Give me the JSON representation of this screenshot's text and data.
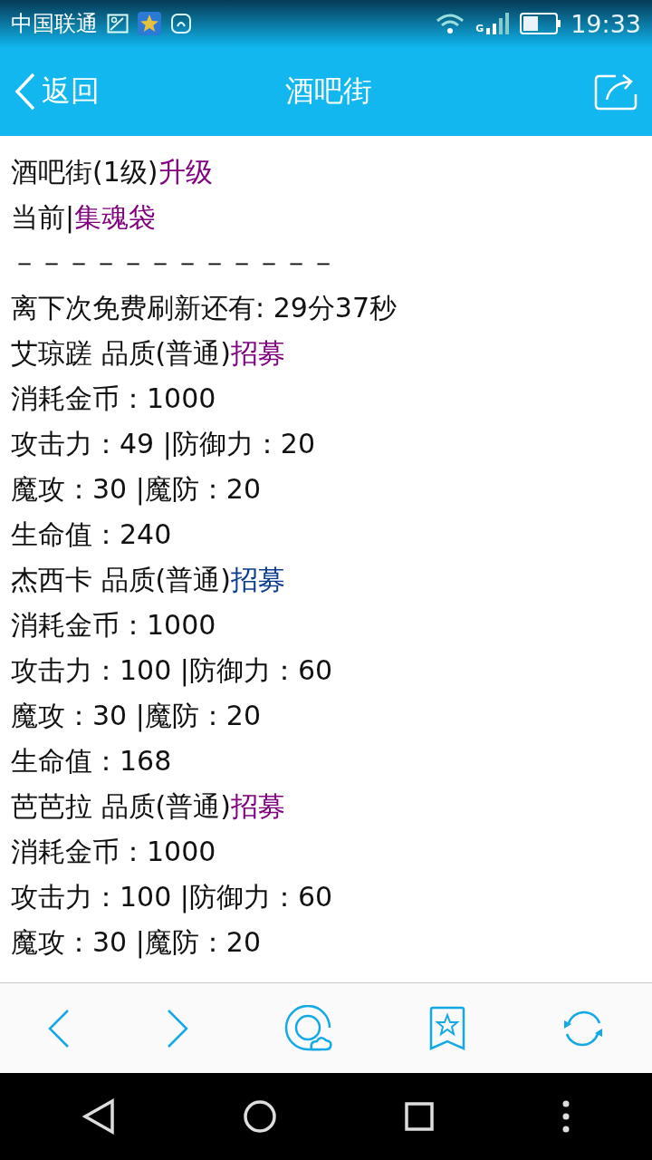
{
  "status_bar": {
    "carrier": "中国联通",
    "network": "G",
    "time": "19:33"
  },
  "title_bar": {
    "back_label": "返回",
    "title": "酒吧街"
  },
  "lines": [
    {
      "text": "酒吧街(1级)",
      "link": {
        "text": "升级",
        "color": "#800080"
      }
    },
    {
      "text": "当前|",
      "link": {
        "text": "集魂袋",
        "color": "#800080"
      }
    },
    {
      "text": "－－－－－－－－－－－－"
    },
    {
      "text": "离下次免费刷新还有: 29分37秒"
    },
    {
      "text": "艾琼蹉 品质(普通)",
      "link": {
        "text": "招募",
        "color": "#800080"
      }
    },
    {
      "text": "消耗金币：1000"
    },
    {
      "text": "攻击力：49 |防御力：20"
    },
    {
      "text": "魔攻：30 |魔防：20"
    },
    {
      "text": "生命值：240"
    },
    {
      "text": "杰西卡 品质(普通)",
      "link": {
        "text": "招募",
        "color": "#0a3d91"
      }
    },
    {
      "text": "消耗金币：1000"
    },
    {
      "text": "攻击力：100 |防御力：60"
    },
    {
      "text": "魔攻：30 |魔防：20"
    },
    {
      "text": "生命值：168"
    },
    {
      "text": "芭芭拉 品质(普通)",
      "link": {
        "text": "招募",
        "color": "#800080"
      }
    },
    {
      "text": "消耗金币：1000"
    },
    {
      "text": "攻击力：100 |防御力：60"
    },
    {
      "text": "魔攻：30 |魔防：20"
    }
  ]
}
